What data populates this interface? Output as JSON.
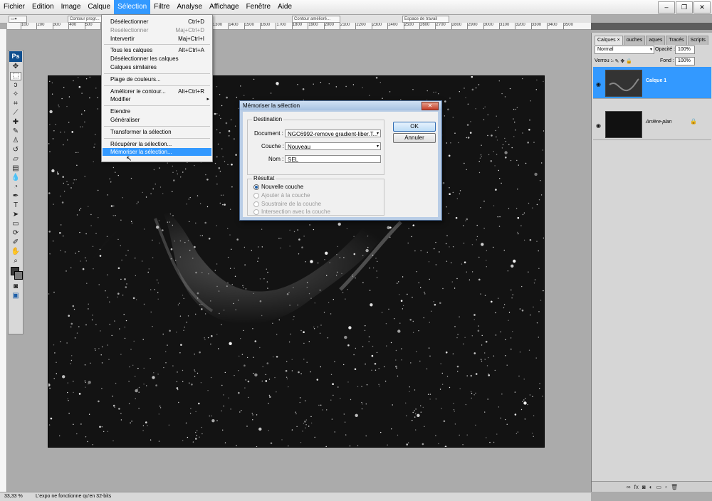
{
  "menubar": {
    "items": [
      "Fichier",
      "Edition",
      "Image",
      "Calque",
      "Sélection",
      "Filtre",
      "Analyse",
      "Affichage",
      "Fenêtre",
      "Aide"
    ],
    "active_index": 4
  },
  "options_bar": {
    "contour_progressif": "Contour progr...",
    "ameliorer_contour": "Contour amélioré...",
    "espace_travail": "Espace de travail"
  },
  "ruler": {
    "ticks": [
      "100",
      "200",
      "300",
      "400",
      "500",
      "600",
      "700",
      "800",
      "900",
      "1000",
      "1100",
      "1200",
      "1300",
      "1400",
      "1500",
      "1600",
      "1700",
      "1800",
      "1900",
      "2000",
      "2100",
      "2200",
      "2300",
      "2400",
      "2500",
      "2600",
      "2700",
      "2800",
      "2900",
      "3000",
      "3100",
      "3200",
      "3300",
      "3400",
      "3500"
    ]
  },
  "toolbox": {
    "logo": "Ps"
  },
  "selection_menu": {
    "items": [
      {
        "label": "Désélectionner",
        "shortcut": "Ctrl+D",
        "enabled": true
      },
      {
        "label": "Resélectionner",
        "shortcut": "Maj+Ctrl+D",
        "enabled": false
      },
      {
        "label": "Intervertir",
        "shortcut": "Maj+Ctrl+I",
        "enabled": true
      },
      {
        "label": "Tous les calques",
        "shortcut": "Alt+Ctrl+A",
        "enabled": true
      },
      {
        "label": "Désélectionner les calques",
        "shortcut": "",
        "enabled": true
      },
      {
        "label": "Calques similaires",
        "shortcut": "",
        "enabled": true
      },
      {
        "label": "Plage de couleurs...",
        "shortcut": "",
        "enabled": true
      },
      {
        "label": "Améliorer le contour...",
        "shortcut": "Alt+Ctrl+R",
        "enabled": true
      },
      {
        "label": "Modifier",
        "shortcut": "",
        "enabled": true
      },
      {
        "label": "Etendre",
        "shortcut": "",
        "enabled": true
      },
      {
        "label": "Généraliser",
        "shortcut": "",
        "enabled": true
      },
      {
        "label": "Transformer la sélection",
        "shortcut": "",
        "enabled": true
      },
      {
        "label": "Récupérer la sélection...",
        "shortcut": "",
        "enabled": true
      },
      {
        "label": "Mémoriser la sélection...",
        "shortcut": "",
        "enabled": true
      }
    ],
    "highlighted_index": 13
  },
  "dialog": {
    "title": "Mémoriser la sélection",
    "destination_label": "Destination",
    "document_label": "Document :",
    "document_value": "NGC6992-remove gradient-liber.T...",
    "couche_label": "Couche :",
    "couche_value": "Nouveau",
    "nom_label": "Nom :",
    "nom_value": "SEL",
    "resultat_label": "Résultat",
    "options": [
      {
        "label": "Nouvelle couche",
        "checked": true,
        "enabled": true
      },
      {
        "label": "Ajouter à la couche",
        "checked": false,
        "enabled": false
      },
      {
        "label": "Soustraire de la couche",
        "checked": false,
        "enabled": false
      },
      {
        "label": "Intersection avec la couche",
        "checked": false,
        "enabled": false
      }
    ],
    "ok_label": "OK",
    "cancel_label": "Annuler"
  },
  "layers_panel": {
    "tabs": [
      "Calques",
      "ouches",
      "aques",
      "Tracés",
      "Scripts"
    ],
    "close_icon": "×",
    "blend_mode": "Normal",
    "opacity_label": "Opacité :",
    "opacity_value": "100%",
    "lock_label": "Verrou :",
    "fill_label": "Fond :",
    "fill_value": "100%",
    "layers": [
      {
        "name": "Calque 1",
        "selected": true,
        "locked": false
      },
      {
        "name": "Arrière-plan",
        "selected": false,
        "locked": true
      }
    ]
  },
  "statusbar": {
    "zoom": "33,33 %",
    "message": "L'expo ne fonctionne qu'en 32-bits"
  },
  "colors": {
    "accent": "#3399ff",
    "menubar": "#ececec",
    "workspace": "#ababab",
    "dialog_frame": "#b9cde6"
  }
}
